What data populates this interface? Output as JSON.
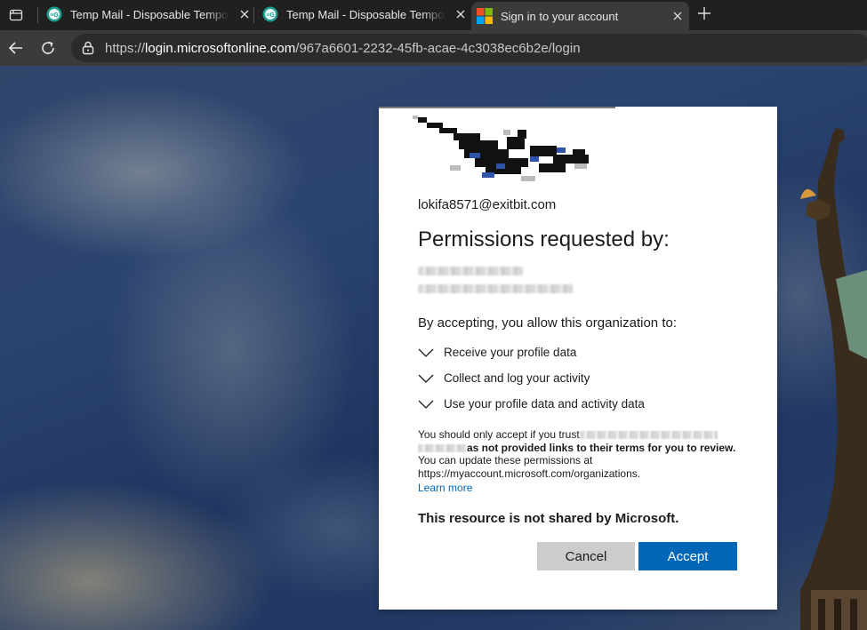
{
  "browser": {
    "tabs": [
      {
        "title": "Temp Mail - Disposable Temporary Email",
        "active": false
      },
      {
        "title": "Temp Mail - Disposable Temporary Email",
        "active": false
      },
      {
        "title": "Sign in to your account",
        "active": true
      }
    ],
    "url_prefix": "https://",
    "url_host": "login.microsoftonline.com",
    "url_path": "/967a6601-2232-45fb-acae-4c3038ec6b2e/login"
  },
  "dialog": {
    "account": "lokifa8571@exitbit.com",
    "heading": "Permissions requested by:",
    "allow_text": "By accepting, you allow this organization to:",
    "permissions": [
      "Receive your profile data",
      "Collect and log your activity",
      "Use your profile data and activity data"
    ],
    "notice_part1": "You should only accept if you trust",
    "notice_bold": "as not provided links to their terms for you to review.",
    "notice_part2": "You can update these permissions at https://myaccount.microsoft.com/organizations.",
    "learn_more": "Learn more",
    "resource_note": "This resource is not shared by Microsoft.",
    "cancel_label": "Cancel",
    "accept_label": "Accept"
  },
  "colors": {
    "accent": "#0067b8",
    "cancel_bg": "#cccccc"
  }
}
